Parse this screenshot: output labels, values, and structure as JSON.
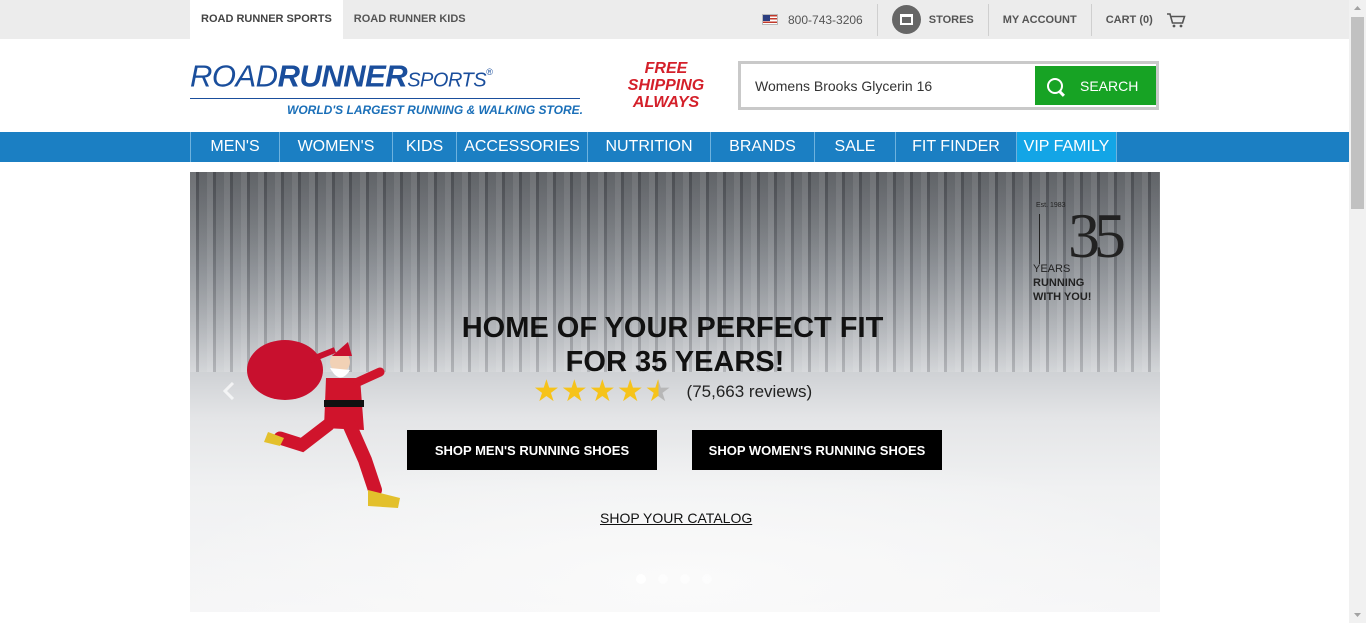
{
  "topbar": {
    "tabs": [
      {
        "label": "ROAD RUNNER SPORTS",
        "active": true
      },
      {
        "label": "ROAD RUNNER KIDS",
        "active": false
      }
    ],
    "phone": "800-743-3206",
    "stores_label": "STORES",
    "account_label": "MY ACCOUNT",
    "cart_label": "CART (0)"
  },
  "header": {
    "logo_road": "ROAD",
    "logo_runner": "RUNNER",
    "logo_sports": "SPORTS",
    "logo_reg": "®",
    "tagline": "WORLD'S LARGEST RUNNING & WALKING STORE.",
    "free_shipping_line1": "FREE",
    "free_shipping_line2": "SHIPPING",
    "free_shipping_line3": "ALWAYS"
  },
  "search": {
    "value": "Womens Brooks Glycerin 16",
    "button_label": "SEARCH"
  },
  "nav": {
    "items": [
      {
        "label": "MEN'S",
        "width": 89
      },
      {
        "label": "WOMEN'S",
        "width": 113
      },
      {
        "label": "KIDS",
        "width": 64
      },
      {
        "label": "ACCESSORIES",
        "width": 131
      },
      {
        "label": "NUTRITION",
        "width": 123
      },
      {
        "label": "BRANDS",
        "width": 104
      },
      {
        "label": "SALE",
        "width": 81
      },
      {
        "label": "FIT FINDER",
        "width": 121
      },
      {
        "label": "VIP FAMILY",
        "width": 100
      }
    ]
  },
  "hero": {
    "badge_est": "Est. 1983",
    "badge_number": "35",
    "badge_years": "YEARS",
    "badge_running": "RUNNING",
    "badge_with_you": "WITH YOU!",
    "headline_line1": "HOME OF YOUR PERFECT FIT",
    "headline_line2": "FOR 35 YEARS!",
    "rating_stars": 4.5,
    "reviews_text": "(75,663 reviews)",
    "cta_men": "SHOP MEN'S RUNNING SHOES",
    "cta_women": "SHOP WOMEN'S RUNNING SHOES",
    "catalog_link": "SHOP YOUR CATALOG",
    "slides": 4,
    "active_slide": 1
  },
  "colors": {
    "brand_blue": "#1a4e9c",
    "nav_blue": "#1b7fc3",
    "vip_blue": "#13a5e6",
    "search_green": "#17a324",
    "free_shipping_red": "#d4202a",
    "star_gold": "#f6c31a"
  },
  "icons": [
    "us-flag-icon",
    "store-icon",
    "cart-icon",
    "search-icon",
    "chevron-left-icon",
    "star-icon"
  ]
}
